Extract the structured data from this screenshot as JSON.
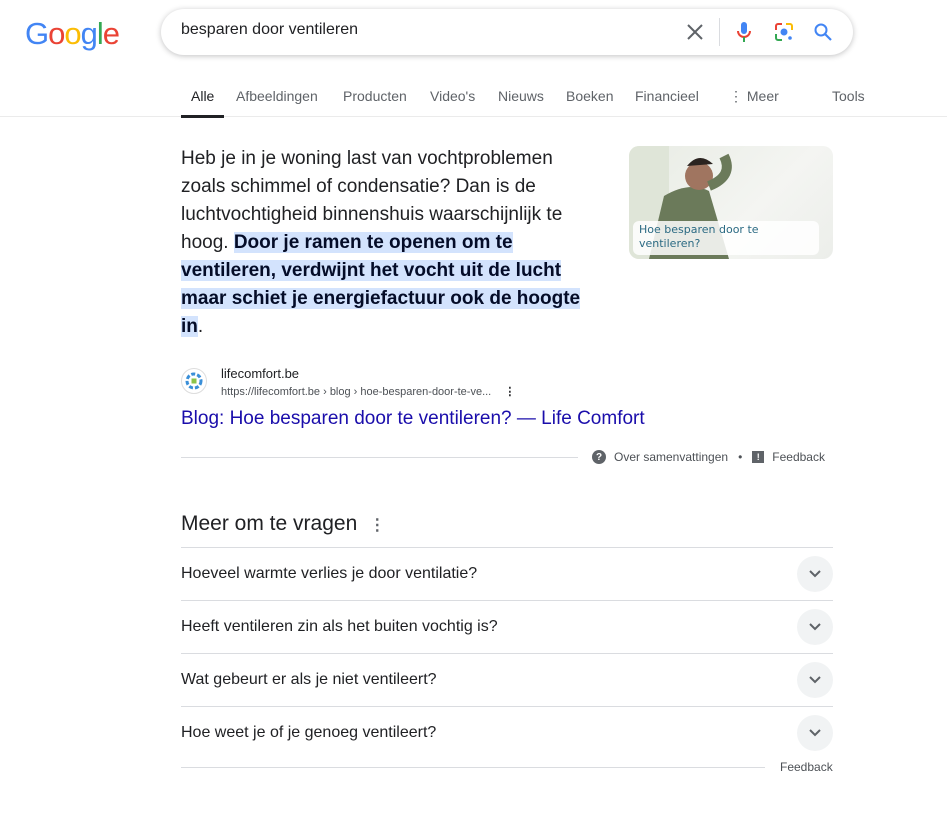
{
  "logo": "Google",
  "search": {
    "query": "besparen door ventileren"
  },
  "tabs": [
    "Alle",
    "Afbeeldingen",
    "Producten",
    "Video's",
    "Nieuws",
    "Boeken",
    "Financieel",
    "Meer"
  ],
  "tools": "Tools",
  "snippet": {
    "text": "Heb je in je woning last van vochtproblemen zoals schimmel of condensatie? Dan is de luchtvochtigheid binnenshuis waarschijnlijk te hoog. ",
    "highlight": "Door je ramen te openen om te ventileren, verdwijnt het vocht uit de lucht maar schiet je energiefactuur ook de hoogte in",
    "end": ".",
    "image_caption": "Hoe besparen door te ventileren?"
  },
  "source": {
    "site": "lifecomfort.be",
    "url": "https://lifecomfort.be › blog › hoe-besparen-door-te-ve...",
    "title": "Blog: Hoe besparen door te ventileren? — Life Comfort"
  },
  "about": "Over samenvattingen",
  "feedback": "Feedback",
  "paa": {
    "title": "Meer om te vragen",
    "questions": [
      "Hoeveel warmte verlies je door ventilatie?",
      "Heeft ventileren zin als het buiten vochtig is?",
      "Wat gebeurt er als je niet ventileert?",
      "Hoe weet je of je genoeg ventileert?"
    ],
    "feedback": "Feedback"
  }
}
